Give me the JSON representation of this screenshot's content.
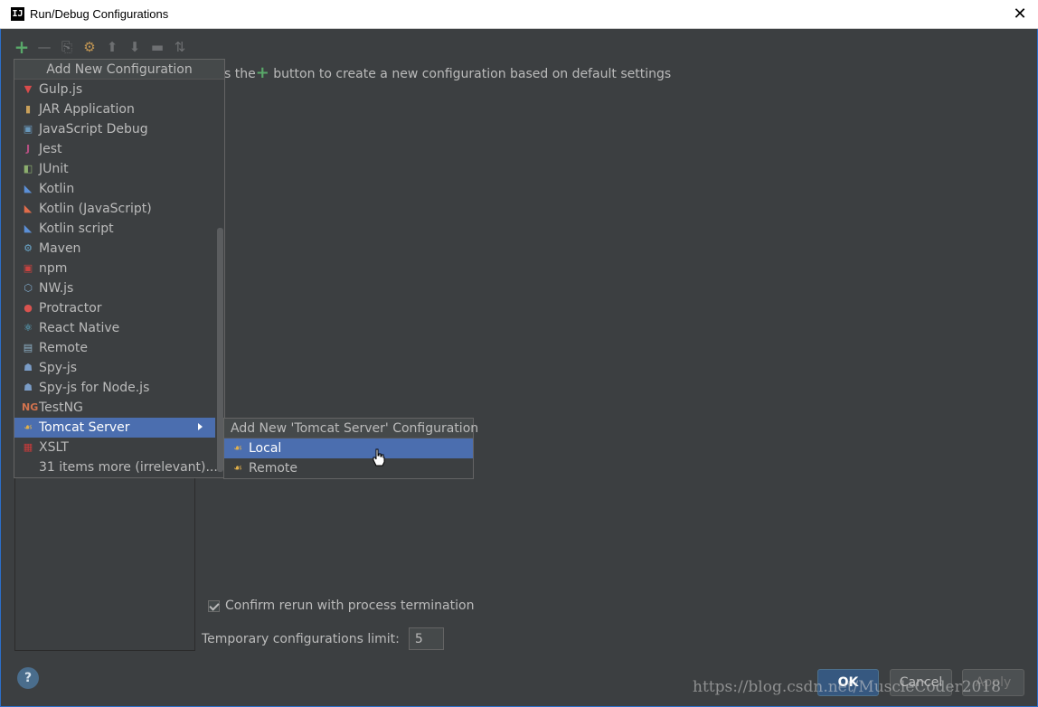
{
  "window": {
    "app_icon": "IJ",
    "title": "Run/Debug Configurations",
    "close": "✕"
  },
  "toolbar": {
    "add": "+",
    "remove": "—",
    "copy": "⎘",
    "edit": "⚙",
    "up": "⬆",
    "down": "⬇",
    "folder": "▬",
    "sort": "⇅"
  },
  "hint": {
    "prefix": "s the",
    "plus": "+",
    "suffix": " button to create a new configuration based on default settings"
  },
  "popup": {
    "header": "Add New Configuration",
    "items": [
      {
        "label": "Gulp.js",
        "icon": "gulp-icon",
        "glyph": "▼",
        "color": "#d94b4b"
      },
      {
        "label": "JAR Application",
        "icon": "jar-icon",
        "glyph": "▮",
        "color": "#c9a05a"
      },
      {
        "label": "JavaScript Debug",
        "icon": "js-debug-icon",
        "glyph": "▣",
        "color": "#6897bb"
      },
      {
        "label": "Jest",
        "icon": "jest-icon",
        "glyph": "J",
        "color": "#b54f82"
      },
      {
        "label": "JUnit",
        "icon": "junit-icon",
        "glyph": "◧",
        "color": "#8cae6e"
      },
      {
        "label": "Kotlin",
        "icon": "kotlin-icon",
        "glyph": "◣",
        "color": "#5b8fd6"
      },
      {
        "label": "Kotlin (JavaScript)",
        "icon": "kotlin-js-icon",
        "glyph": "◣",
        "color": "#e06c4a"
      },
      {
        "label": "Kotlin script",
        "icon": "kotlin-script-icon",
        "glyph": "◣",
        "color": "#5b8fd6"
      },
      {
        "label": "Maven",
        "icon": "maven-icon",
        "glyph": "⚙",
        "color": "#6aa5c8"
      },
      {
        "label": "npm",
        "icon": "npm-icon",
        "glyph": "▣",
        "color": "#c9423f"
      },
      {
        "label": "NW.js",
        "icon": "nwjs-icon",
        "glyph": "⬡",
        "color": "#7fa8c9"
      },
      {
        "label": "Protractor",
        "icon": "protractor-icon",
        "glyph": "●",
        "color": "#d9534f"
      },
      {
        "label": "React Native",
        "icon": "react-icon",
        "glyph": "⚛",
        "color": "#61c4e6"
      },
      {
        "label": "Remote",
        "icon": "remote-icon",
        "glyph": "▤",
        "color": "#8fb3c9"
      },
      {
        "label": "Spy-js",
        "icon": "spyjs-icon",
        "glyph": "☗",
        "color": "#7a9cc6"
      },
      {
        "label": "Spy-js for Node.js",
        "icon": "spyjs-node-icon",
        "glyph": "☗",
        "color": "#7a9cc6"
      },
      {
        "label": "TestNG",
        "icon": "testng-icon",
        "glyph": "NG",
        "color": "#d2734e"
      },
      {
        "label": "Tomcat Server",
        "icon": "tomcat-icon",
        "glyph": "☙",
        "color": "#e2b14a",
        "selected": true
      },
      {
        "label": "XSLT",
        "icon": "xslt-icon",
        "glyph": "▦",
        "color": "#c93b3b"
      },
      {
        "label": "31 items more (irrelevant)...",
        "icon": "",
        "glyph": "",
        "color": ""
      }
    ]
  },
  "submenu": {
    "header": "Add New 'Tomcat Server' Configuration",
    "items": [
      {
        "label": "Local",
        "icon": "tomcat-icon",
        "glyph": "☙",
        "color": "#e2b14a",
        "selected": true
      },
      {
        "label": "Remote",
        "icon": "tomcat-icon",
        "glyph": "☙",
        "color": "#e2b14a"
      }
    ]
  },
  "settings": {
    "confirm_rerun": "Confirm rerun with process termination",
    "limit_label": "Temporary configurations limit:",
    "limit_value": "5"
  },
  "footer": {
    "help": "?",
    "ok": "OK",
    "cancel": "Cancel",
    "apply": "Apply"
  },
  "watermark": "https://blog.csdn.net/MuscleCoder2018"
}
